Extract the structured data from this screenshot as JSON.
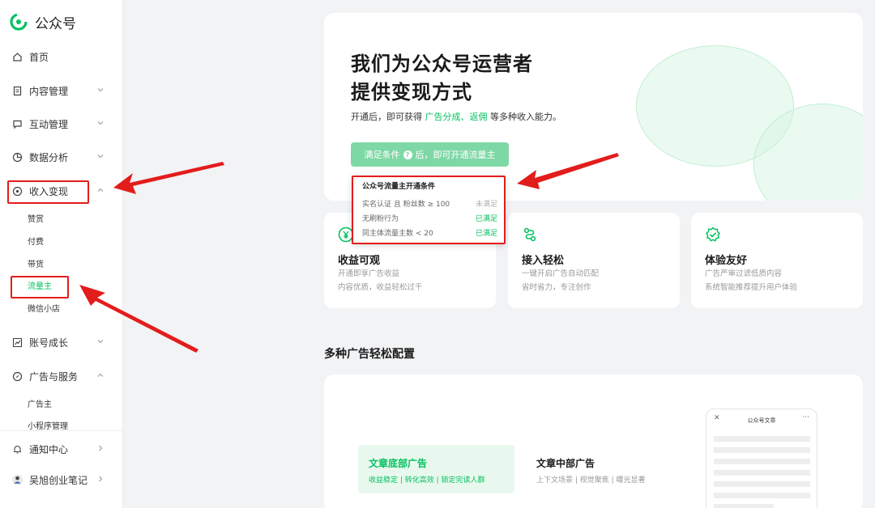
{
  "app": {
    "name": "公众号"
  },
  "sidebar": {
    "items": [
      {
        "label": "首页"
      },
      {
        "label": "内容管理"
      },
      {
        "label": "互动管理"
      },
      {
        "label": "数据分析"
      },
      {
        "label": "收入变现"
      },
      {
        "label": "账号成长"
      },
      {
        "label": "广告与服务"
      },
      {
        "label": "通知中心"
      },
      {
        "label": "吴旭创业笔记"
      }
    ],
    "income_sub": [
      "赞赏",
      "付费",
      "带货",
      "流量主",
      "微信小店"
    ],
    "ads_sub": [
      "广告主",
      "小程序管理"
    ],
    "active_sub": "流量主"
  },
  "hero": {
    "title_line1": "我们为公众号运营者",
    "title_line2": "提供变现方式",
    "desc_pre": "开通后，即可获得 ",
    "desc_link1": "广告分成",
    "desc_sep": "、",
    "desc_link2": "返佣",
    "desc_post": " 等多种收入能力。",
    "button_pre": "满足条件",
    "button_post": "后，即可开通流量主"
  },
  "conditions": {
    "title": "公众号流量主开通条件",
    "rows": [
      {
        "label": "实名认证 且 粉丝数 ≥ 100",
        "status": "未满足",
        "met": false
      },
      {
        "label": "无刷粉行为",
        "status": "已满足",
        "met": true
      },
      {
        "label": "同主体流量主数 < 20",
        "status": "已满足",
        "met": true
      }
    ]
  },
  "features": [
    {
      "icon": "yen-icon",
      "title": "收益可观",
      "line1": "开通即享广告收益",
      "line2": "内容优质，收益轻松过千"
    },
    {
      "icon": "link-icon",
      "title": "接入轻松",
      "line1": "一键开启广告自动匹配",
      "line2": "省时省力，专注创作"
    },
    {
      "icon": "shield-check-icon",
      "title": "体验友好",
      "line1": "广告严审过滤低质内容",
      "line2": "系统智能推荐提升用户体验"
    }
  ],
  "section": {
    "title": "多种广告轻松配置"
  },
  "ads": {
    "option1": {
      "title": "文章底部广告",
      "tags": "收益稳定  |  转化高效  |  锁定完读人群"
    },
    "option2": {
      "title": "文章中部广告",
      "tags": "上下文场景  |  视觉聚焦  |  曝光显著"
    },
    "phone_title": "公众号文章",
    "phone_close": "✕",
    "phone_more": "···"
  },
  "colors": {
    "brand_green": "#07c160",
    "highlight_red": "#e31c1c"
  }
}
